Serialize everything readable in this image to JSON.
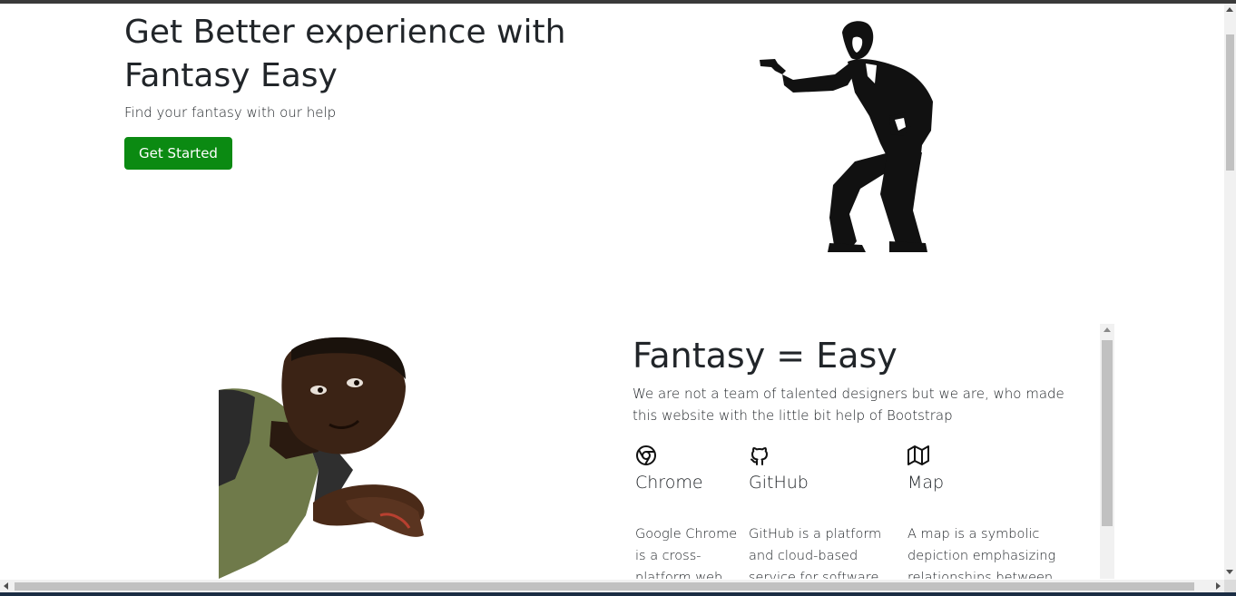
{
  "hero": {
    "title": "Get Better experience with Fantasy Easy",
    "subtitle": "Find your fantasy with our help",
    "cta_label": "Get Started"
  },
  "about": {
    "title": "Fantasy = Easy",
    "description": "We are not a team of talented designers but we are, who made this website with the little bit help of Bootstrap",
    "features": [
      {
        "icon": "chrome-icon",
        "name": "Chrome",
        "text": "Google Chrome is a cross-platform web"
      },
      {
        "icon": "github-icon",
        "name": "GitHub",
        "text": "GitHub is a platform and cloud-based service for software development"
      },
      {
        "icon": "map-icon",
        "name": "Map",
        "text": "A map is a symbolic depiction emphasizing relationships between elements of some"
      }
    ]
  },
  "colors": {
    "accent": "#0b8a12",
    "text": "#212529"
  }
}
